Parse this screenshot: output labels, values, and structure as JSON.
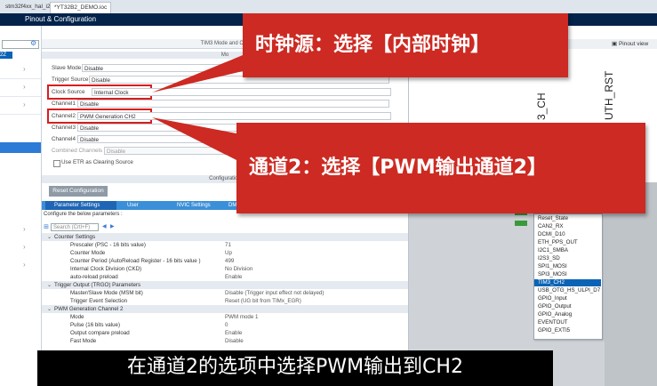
{
  "tabs": [
    {
      "label": "stm32f4xx_hal_i2c.c"
    },
    {
      "label": "*YT32B2_DEMO.ioc"
    }
  ],
  "header": {
    "title": "Pinout & Configuration"
  },
  "sidebar": {
    "selected_label": "2Z"
  },
  "mode_panel": {
    "title": "TIM3 Mode and Con",
    "section": "Mo",
    "fields": [
      {
        "label": "Slave Mode",
        "value": "Disable"
      },
      {
        "label": "Trigger Source",
        "value": "Disable"
      },
      {
        "label": "Clock Source",
        "value": "Internal Clock"
      },
      {
        "label": "Channel1",
        "value": "Disable"
      },
      {
        "label": "Channel2",
        "value": "PWM Generation CH2"
      },
      {
        "label": "Channel3",
        "value": "Disable"
      },
      {
        "label": "Channel4",
        "value": "Disable"
      },
      {
        "label": "Combined Channels",
        "value": "Disable"
      }
    ],
    "etr_checkbox": "Use ETR as Clearing Source"
  },
  "config": {
    "title": "Configuration",
    "reset_button": "Reset Configuration",
    "tabs": [
      "Parameter Settings",
      "User Constants",
      "NVIC Settings",
      "DM"
    ],
    "instruction": "Configure the below parameters :",
    "search_placeholder": "Search (Crtl+F)",
    "rows": [
      {
        "group": true,
        "key": "Counter Settings",
        "value": ""
      },
      {
        "key": "Prescaler (PSC - 16 bits value)",
        "value": "71"
      },
      {
        "key": "Counter Mode",
        "value": "Up"
      },
      {
        "key": "Counter Period (AutoReload Register - 16 bits value )",
        "value": "499"
      },
      {
        "key": "Internal Clock Division (CKD)",
        "value": "No Division"
      },
      {
        "key": "auto-reload preload",
        "value": "Enable"
      },
      {
        "group": true,
        "key": "Trigger Output (TRGO) Parameters",
        "value": ""
      },
      {
        "key": "Master/Slave Mode (MSM bit)",
        "value": "Disable (Trigger input effect not delayed)"
      },
      {
        "key": "Trigger Event Selection",
        "value": "Reset (UG bit from TIMx_EGR)"
      },
      {
        "group": true,
        "key": "PWM Generation Channel 2",
        "value": ""
      },
      {
        "key": "Mode",
        "value": "PWM mode 1"
      },
      {
        "key": "Pulse (16 bits value)",
        "value": "0"
      },
      {
        "key": "Output compare preload",
        "value": "Enable"
      },
      {
        "key": "Fast Mode",
        "value": "Disable"
      }
    ]
  },
  "pinout": {
    "view_label": "Pinout view",
    "pin_labels": [
      "3_CH",
      "UTH_RST"
    ],
    "menu_items": [
      "Reset_State",
      "CAN2_RX",
      "DCMI_D10",
      "ETH_PPS_OUT",
      "I2C1_SMBA",
      "I2S3_SD",
      "SPI1_MOSI",
      "SPI3_MOSI",
      "TIM3_CH2",
      "USB_OTG_HS_ULPI_D7",
      "GPIO_Input",
      "GPIO_Output",
      "GPIO_Analog",
      "EVENTOUT",
      "GPIO_EXTI5"
    ],
    "selected_item": "TIM3_CH2"
  },
  "callouts": {
    "clock": "时钟源：选择【内部时钟】",
    "channel": "通道2：选择【PWM输出通道2】"
  },
  "subtitle": "在通道2的选项中选择PWM输出到CH2",
  "colors": {
    "header": "#03234b",
    "callout": "#cc2a22",
    "highlight": "#d81e1e",
    "selection": "#0b63b6"
  }
}
